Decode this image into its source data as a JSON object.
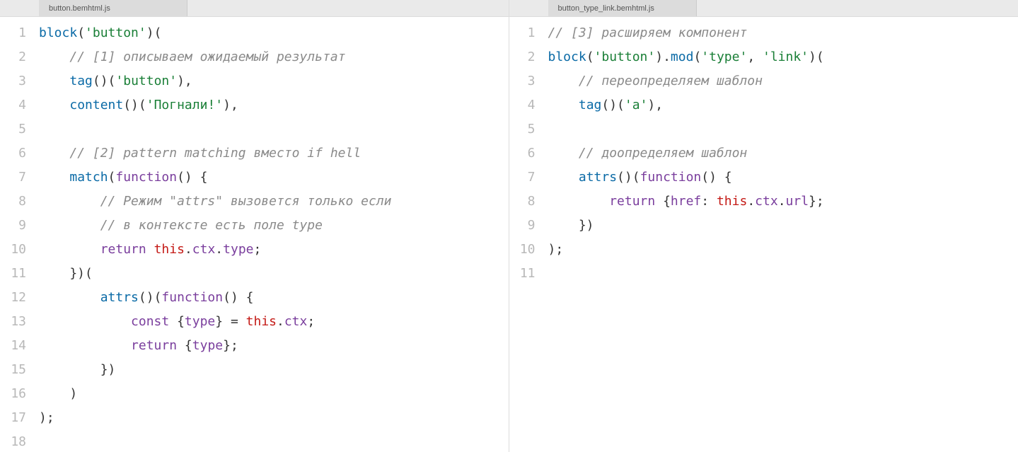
{
  "left": {
    "tab": "button.bemhtml.js",
    "lines": [
      "1",
      "2",
      "3",
      "4",
      "5",
      "6",
      "7",
      "8",
      "9",
      "10",
      "11",
      "12",
      "13",
      "14",
      "15",
      "16",
      "17",
      "18"
    ],
    "c": {
      "block": "block",
      "str_button": "'button'",
      "cmt1": "// [1] описываем ожидаемый результат",
      "tag": "tag",
      "content": "content",
      "str_pognali": "'Погнали!'",
      "cmt2": "// [2] pattern matching вместо if hell",
      "match": "match",
      "function": "function",
      "cmt3": "// Режим \"attrs\" вызовется только если",
      "cmt4": "// в контексте есть поле type",
      "return": "return",
      "this": "this",
      "ctx": "ctx",
      "type": "type",
      "attrs": "attrs",
      "const": "const"
    }
  },
  "right": {
    "tab": "button_type_link.bemhtml.js",
    "lines": [
      "1",
      "2",
      "3",
      "4",
      "5",
      "6",
      "7",
      "8",
      "9",
      "10",
      "11"
    ],
    "c": {
      "cmt1": "// [3] расширяем компонент",
      "block": "block",
      "str_button": "'button'",
      "mod": "mod",
      "str_type": "'type'",
      "str_link": "'link'",
      "cmt2": "// переопределяем шаблон",
      "tag": "tag",
      "str_a": "'a'",
      "cmt3": "// доопределяем шаблон",
      "attrs": "attrs",
      "function": "function",
      "return": "return",
      "href": "href",
      "this": "this",
      "ctx": "ctx",
      "url": "url"
    }
  }
}
